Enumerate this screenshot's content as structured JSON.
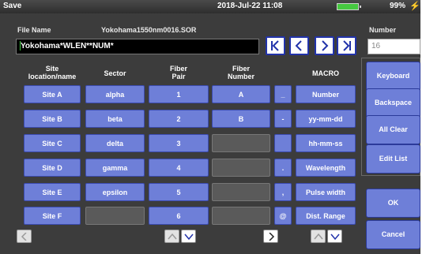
{
  "status": {
    "title": "Save",
    "datetime": "2018-Jul-22 11:08",
    "battery_percent": "99%",
    "battery_level": 0.99
  },
  "file": {
    "label": "File Name",
    "current_name": "Yokohama1550nm0016.SOR",
    "value": "Yokohama*WLEN**NUM*"
  },
  "number": {
    "label": "Number",
    "value": "16"
  },
  "columns": {
    "site": "Site\nlocation/name",
    "sector": "Sector",
    "fiber_pair": "Fiber\nPair",
    "fiber_number": "Fiber\nNumber",
    "macro": "MACRO"
  },
  "rows": [
    {
      "site": "Site A",
      "sector": "alpha",
      "pair": "1",
      "fiber": "A",
      "sym": "_",
      "macro": "Number"
    },
    {
      "site": "Site B",
      "sector": "beta",
      "pair": "2",
      "fiber": "B",
      "sym": "-",
      "macro": "yy-mm-dd"
    },
    {
      "site": "Site C",
      "sector": "delta",
      "pair": "3",
      "fiber": "",
      "sym": "",
      "macro": "hh-mm-ss"
    },
    {
      "site": "Site D",
      "sector": "gamma",
      "pair": "4",
      "fiber": "",
      "sym": ".",
      "macro": "Wavelength"
    },
    {
      "site": "Site E",
      "sector": "epsilon",
      "pair": "5",
      "fiber": "",
      "sym": ",",
      "macro": "Pulse width"
    },
    {
      "site": "Site F",
      "sector": "",
      "pair": "6",
      "fiber": "",
      "sym": "@",
      "macro": "Dist. Range"
    }
  ],
  "side": {
    "keyboard": "Keyboard",
    "backspace": "Backspace",
    "all_clear": "All Clear",
    "edit_list": "Edit List",
    "ok": "OK",
    "cancel": "Cancel"
  },
  "icons": {
    "first": "skip-first-icon",
    "prev": "chevron-left-icon",
    "next": "chevron-right-icon",
    "last": "skip-last-icon",
    "plug": "power-plug-icon"
  },
  "colors": {
    "button_blue": "#6e7fd8",
    "background": "#3c3c3c",
    "battery": "#46c840"
  }
}
